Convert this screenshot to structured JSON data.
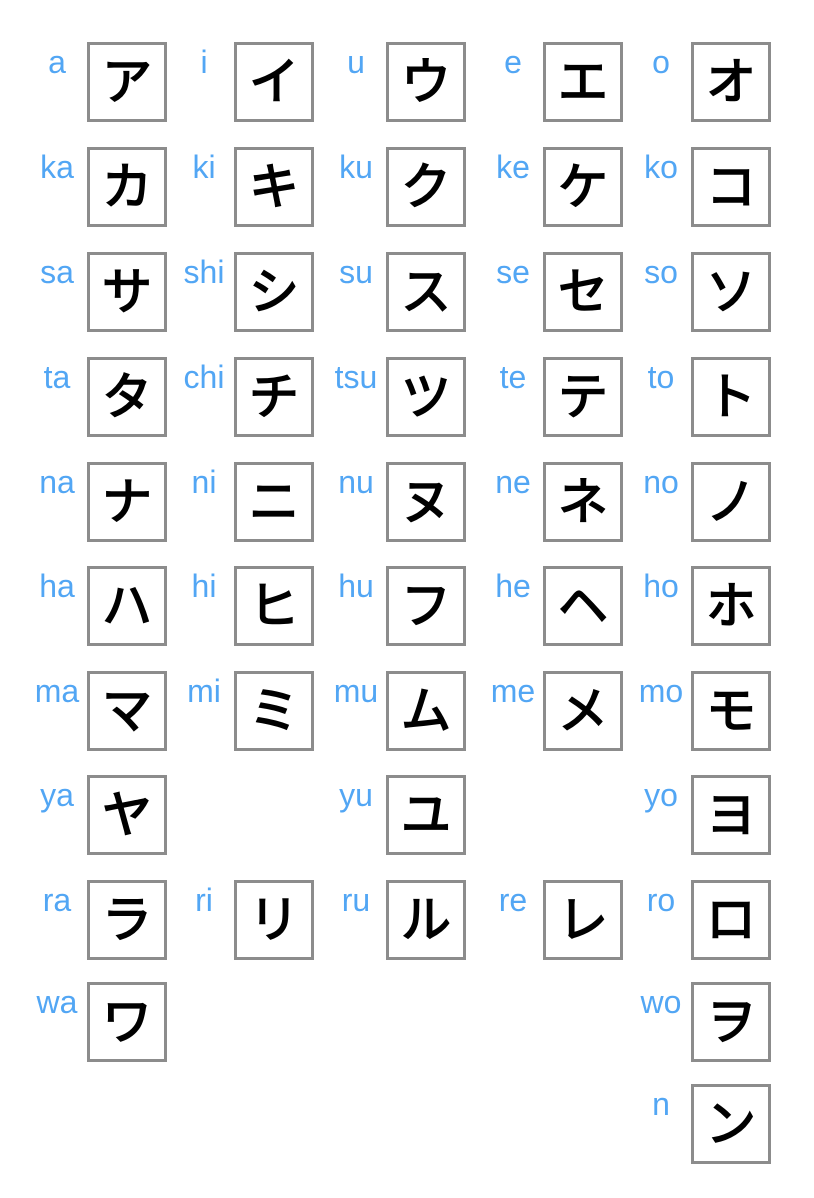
{
  "colors": {
    "label": "#52a6f4",
    "border": "#8c8c8c",
    "glyph": "#000000"
  },
  "rows": [
    [
      {
        "r": "a",
        "k": "ア"
      },
      {
        "r": "i",
        "k": "イ"
      },
      {
        "r": "u",
        "k": "ウ"
      },
      {
        "r": "e",
        "k": "エ"
      },
      {
        "r": "o",
        "k": "オ"
      }
    ],
    [
      {
        "r": "ka",
        "k": "カ"
      },
      {
        "r": "ki",
        "k": "キ"
      },
      {
        "r": "ku",
        "k": "ク"
      },
      {
        "r": "ke",
        "k": "ケ"
      },
      {
        "r": "ko",
        "k": "コ"
      }
    ],
    [
      {
        "r": "sa",
        "k": "サ"
      },
      {
        "r": "shi",
        "k": "シ"
      },
      {
        "r": "su",
        "k": "ス"
      },
      {
        "r": "se",
        "k": "セ"
      },
      {
        "r": "so",
        "k": "ソ"
      }
    ],
    [
      {
        "r": "ta",
        "k": "タ"
      },
      {
        "r": "chi",
        "k": "チ"
      },
      {
        "r": "tsu",
        "k": "ツ"
      },
      {
        "r": "te",
        "k": "テ"
      },
      {
        "r": "to",
        "k": "ト"
      }
    ],
    [
      {
        "r": "na",
        "k": "ナ"
      },
      {
        "r": "ni",
        "k": "ニ"
      },
      {
        "r": "nu",
        "k": "ヌ"
      },
      {
        "r": "ne",
        "k": "ネ"
      },
      {
        "r": "no",
        "k": "ノ"
      }
    ],
    [
      {
        "r": "ha",
        "k": "ハ"
      },
      {
        "r": "hi",
        "k": "ヒ"
      },
      {
        "r": "hu",
        "k": "フ"
      },
      {
        "r": "he",
        "k": "ヘ"
      },
      {
        "r": "ho",
        "k": "ホ"
      }
    ],
    [
      {
        "r": "ma",
        "k": "マ"
      },
      {
        "r": "mi",
        "k": "ミ"
      },
      {
        "r": "mu",
        "k": "ム"
      },
      {
        "r": "me",
        "k": "メ"
      },
      {
        "r": "mo",
        "k": "モ"
      }
    ],
    [
      {
        "r": "ya",
        "k": "ヤ"
      },
      null,
      {
        "r": "yu",
        "k": "ユ"
      },
      null,
      {
        "r": "yo",
        "k": "ヨ"
      }
    ],
    [
      {
        "r": "ra",
        "k": "ラ"
      },
      {
        "r": "ri",
        "k": "リ"
      },
      {
        "r": "ru",
        "k": "ル"
      },
      {
        "r": "re",
        "k": "レ"
      },
      {
        "r": "ro",
        "k": "ロ"
      }
    ],
    [
      {
        "r": "wa",
        "k": "ワ"
      },
      null,
      null,
      null,
      {
        "r": "wo",
        "k": "ヲ"
      }
    ],
    [
      null,
      null,
      null,
      null,
      {
        "r": "n",
        "k": "ン"
      }
    ]
  ]
}
